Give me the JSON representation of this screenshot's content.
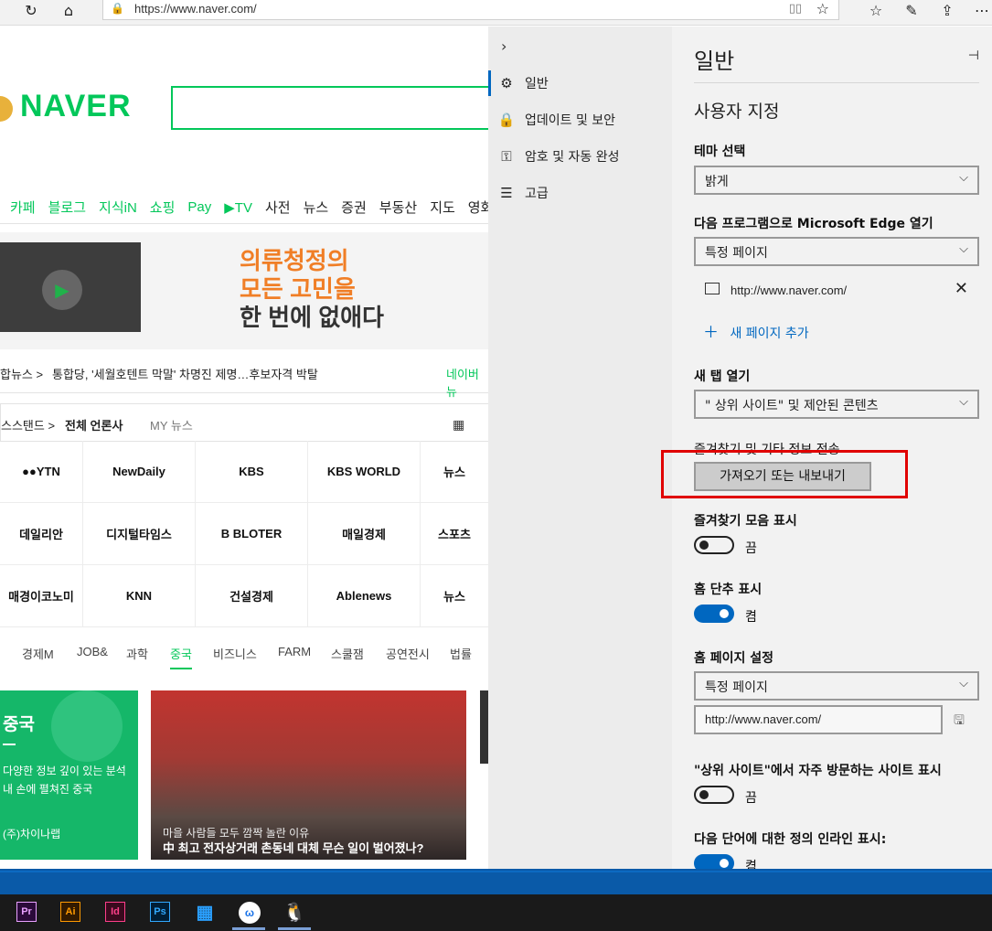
{
  "browser": {
    "url": "https://www.naver.com/",
    "icons": [
      "refresh-icon",
      "home-icon",
      "lock-icon",
      "reading-view-icon",
      "star-icon",
      "favorites-icon",
      "pen-icon",
      "share-icon",
      "more-icon"
    ]
  },
  "naver": {
    "logo": "NAVER",
    "nav": [
      "카페",
      "블로그",
      "지식iN",
      "쇼핑",
      "Pay",
      "▶TV",
      "사전",
      "뉴스",
      "증권",
      "부동산",
      "지도",
      "영화"
    ],
    "nav_green_count": 6,
    "ad_lines": [
      "의류청정의",
      "모든 고민을",
      "한 번에 없애다"
    ],
    "news": {
      "label": "합뉴스 >",
      "headline": "통합당, '세월호텐트 막말' 차명진 제명…후보자격 박탈",
      "right": "네이버뉴"
    },
    "press": {
      "tab1": "스스탠드 >",
      "tab2": "전체 언론사",
      "tab3": "MY 뉴스",
      "outlets": [
        "●●YTN",
        "NewDaily",
        "KBS",
        "KBS WORLD",
        "뉴스",
        "데일리안",
        "디지털타임스",
        "B BLOTER",
        "매일경제",
        "스포츠",
        "매경이코노미",
        "KNN",
        "건설경제",
        "Ablenews",
        "뉴스"
      ]
    },
    "tabs": [
      "경제M",
      "JOB&",
      "과학",
      "중국",
      "비즈니스",
      "FARM",
      "스쿨잼",
      "공연전시",
      "법률"
    ],
    "active_tab": "중국",
    "card_green": {
      "title": "중국",
      "line1": "다양한 정보 깊이 있는 분석",
      "line2": "내 손에 펼쳐진 중국",
      "footer": "(주)차이나랩"
    },
    "card_photo": {
      "caption": "마을 사람들 모두 깜짝 놀란 이유",
      "headline": "中 최고 전자상거래 촌동네 대체 무슨 일이 벌어졌나?"
    }
  },
  "settings": {
    "sidebar": [
      {
        "label": "일반",
        "icon": "gear-icon",
        "glyph": "⚙"
      },
      {
        "label": "업데이트 및 보안",
        "icon": "lock-icon",
        "glyph": "🔒"
      },
      {
        "label": "암호 및 자동 완성",
        "icon": "key-icon",
        "glyph": "⚿"
      },
      {
        "label": "고급",
        "icon": "sliders-icon",
        "glyph": "☰"
      }
    ],
    "title": "일반",
    "subtitle": "사용자 지정",
    "theme_label": "테마 선택",
    "theme_value": "밝게",
    "open_with_label": "다음 프로그램으로 Microsoft Edge 열기",
    "open_with_value": "특정 페이지",
    "page_url": "http://www.naver.com/",
    "add_page": "새 페이지 추가",
    "new_tab_label": "새 탭 열기",
    "new_tab_value": "\" 상위 사이트\"  및 제안된 콘텐츠",
    "transfer_label": "즐겨찾기 및 기타 정보 전송",
    "import_button": "가져오기 또는 내보내기",
    "fav_bar_label": "즐겨찾기 모음 표시",
    "fav_bar_state": "끔",
    "home_btn_label": "홈 단추 표시",
    "home_btn_state": "켬",
    "home_page_label": "홈 페이지 설정",
    "home_page_value": "특정 페이지",
    "home_page_url": "http://www.naver.com/",
    "top_sites_label": "\"상위 사이트\"에서 자주 방문하는 사이트 표시",
    "top_sites_state": "끔",
    "definitions_label": "다음 단어에 대한 정의 인라인 표시:",
    "definitions_state": "켬",
    "accent": "#0067c0",
    "highlight": "#e00000"
  },
  "taskbar": {
    "apps": [
      "Pr",
      "Ai",
      "Id",
      "Ps",
      "start-icon",
      "whale-icon",
      "tux-icon"
    ]
  }
}
